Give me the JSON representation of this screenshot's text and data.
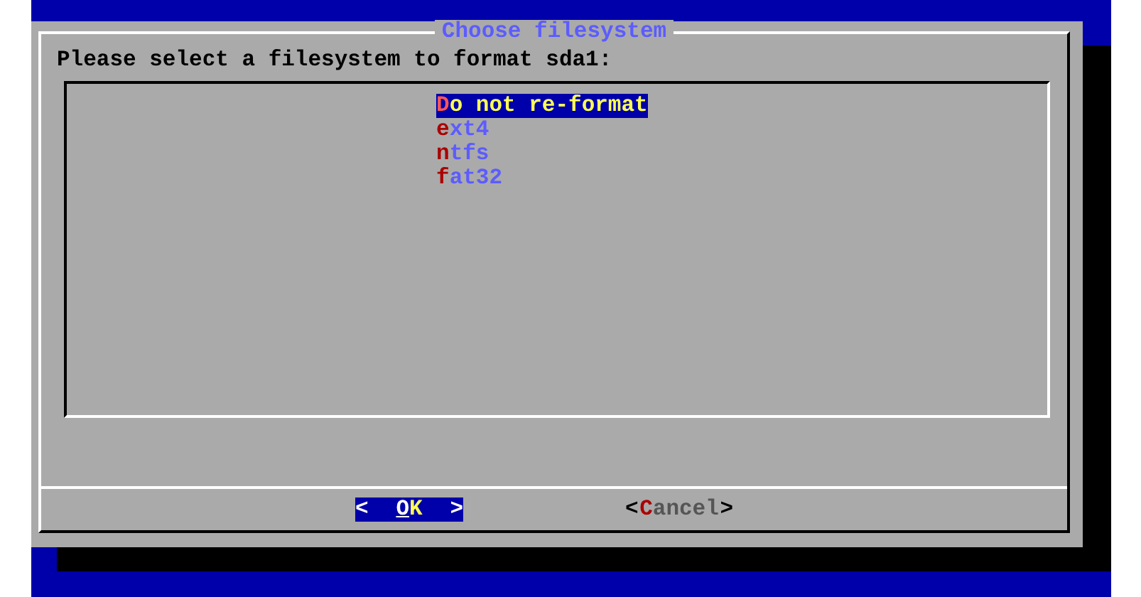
{
  "dialog": {
    "title": "Choose filesystem",
    "prompt": "Please select a filesystem to format sda1:",
    "items": [
      {
        "label": "Do not re-format",
        "selected": true
      },
      {
        "label": "ext4",
        "selected": false
      },
      {
        "label": "ntfs",
        "selected": false
      },
      {
        "label": "fat32",
        "selected": false
      }
    ],
    "buttons": [
      {
        "open": "<",
        "label": "OK",
        "close": ">",
        "selected": true
      },
      {
        "open": "<",
        "label": "Cancel",
        "close": ">",
        "selected": false
      }
    ]
  }
}
